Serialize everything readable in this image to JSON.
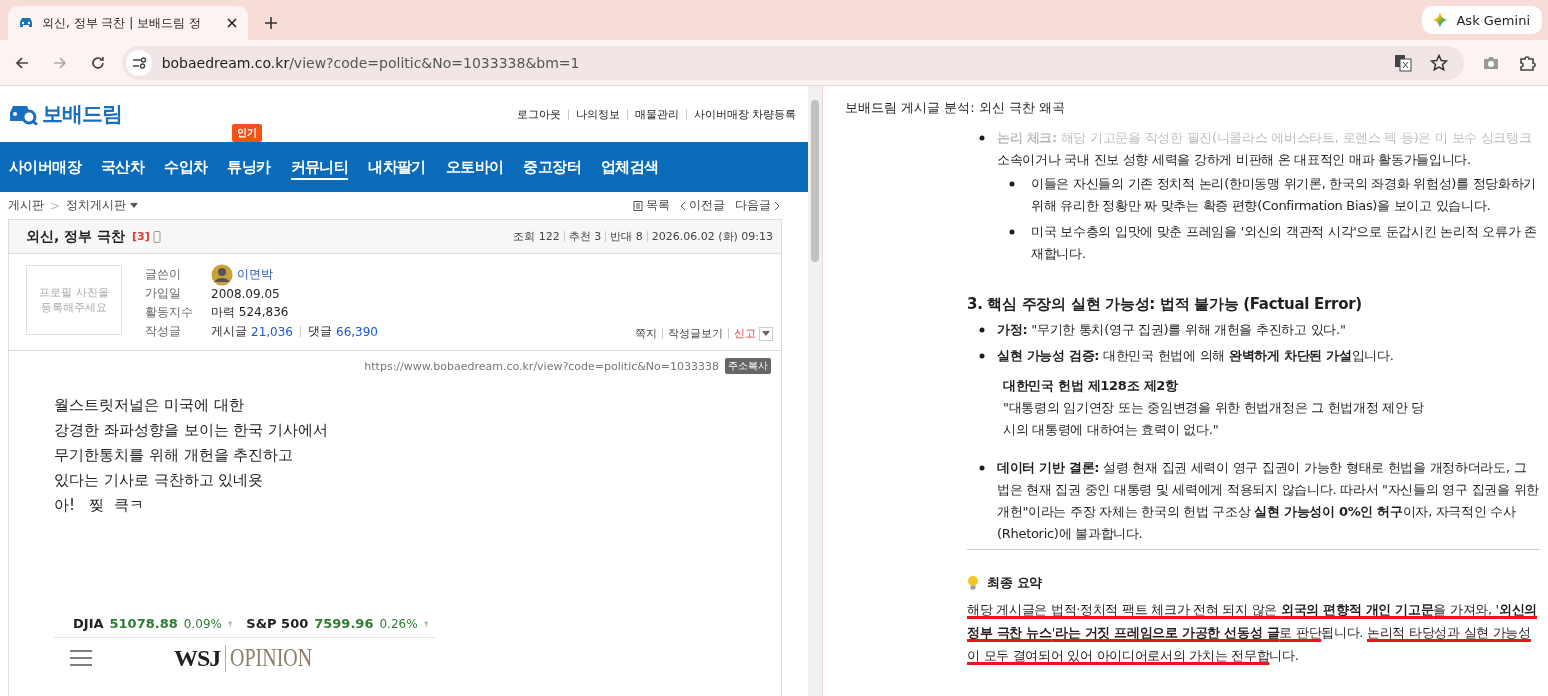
{
  "browser": {
    "tab_title": "외신, 정부 극찬 | 보배드림 정",
    "url_host": "bobaedream.co.kr",
    "url_path": "/view?code=politic&No=1033338&bm=1",
    "ask_button": "Ask Gemini"
  },
  "site": {
    "logo": "보배드림",
    "top_links": [
      "로그아웃",
      "나의정보",
      "매물관리",
      "사이버매장 차량등록"
    ],
    "nav": [
      {
        "label": "사이버매장",
        "selected": false
      },
      {
        "label": "국산차",
        "selected": false
      },
      {
        "label": "수입차",
        "selected": false
      },
      {
        "label": "튜닝카",
        "selected": false,
        "badge": "인기"
      },
      {
        "label": "커뮤니티",
        "selected": true
      },
      {
        "label": "내차팔기",
        "selected": false
      },
      {
        "label": "오토바이",
        "selected": false
      },
      {
        "label": "중고장터",
        "selected": false
      },
      {
        "label": "업체검색",
        "selected": false
      }
    ],
    "breadcrumb": [
      "게시판",
      "정치게시판"
    ],
    "breadcrumb_separator": ">",
    "post_nav": [
      {
        "label": "목록",
        "kind": "list"
      },
      {
        "label": "이전글",
        "kind": "prev"
      },
      {
        "label": "다음글",
        "kind": "next"
      }
    ]
  },
  "post": {
    "title": "외신, 정부 극찬",
    "comment_count": "[3]",
    "stats": [
      "조회 122",
      "추천 3",
      "반대 8",
      "2026.06.02 (화) 09:13"
    ],
    "profile_placeholder": "프로필 사진을 등록해주세요",
    "fields": [
      {
        "label": "글쓴이",
        "kind": "author",
        "value": "이면박"
      },
      {
        "label": "가입일",
        "kind": "text",
        "value": "2008.09.05"
      },
      {
        "label": "활동지수",
        "kind": "text",
        "value": "마력 524,836"
      },
      {
        "label": "작성글",
        "kind": "counts",
        "counts": [
          {
            "label": "게시글",
            "count": "21,036"
          },
          {
            "label": "댓글",
            "count": "66,390"
          }
        ]
      }
    ],
    "actions": [
      {
        "label": "쪽지",
        "kind": "normal"
      },
      {
        "label": "작성글보기",
        "kind": "normal"
      },
      {
        "label": "신고",
        "kind": "report"
      }
    ],
    "permalink": "https://www.bobaedream.co.kr/view?code=politic&No=1033338",
    "copy_button": "주소복사",
    "body": [
      "월스트릿저널은 미국에 대한",
      "강경한 좌파성향을 보이는 한국 기사에서",
      "무기한통치를 위해 개헌을 추진하고",
      "있다는 기사로 극찬하고 있네욧",
      "아!   찢  큭ㅋ"
    ],
    "embed": {
      "tickers": [
        {
          "name": "DJIA",
          "value": "51078.88",
          "change": "0.09%"
        },
        {
          "name": "S&P 500",
          "value": "7599.96",
          "change": "0.26%"
        }
      ],
      "brand": "WSJ",
      "section": "OPINION"
    }
  },
  "assistant": {
    "title": "보배드림 게시글 분석: 외신 극찬 왜곡",
    "blocks": [
      {
        "kind": "bullet",
        "faded": true,
        "text": "**논리 체크:** 해당 기고문을 작성한 필진(니콜라스 에버스타트, 로렌스 펙 등)은 미 보수 싱크탱크 소속이거나 국내 진보 성향 세력을 강하게 비판해 온 대표적인 매파 활동가들입니다.",
        "children": [
          {
            "kind": "bullet",
            "faded": false,
            "text": "이들은 자신들의 기존 정치적 논리(한미동맹 위기론, 한국의 좌경화 위험성)를 정당화하기 위해 유리한 정황만 짜 맞추는 확증 편향(Confirmation Bias)을 보이고 있습니다."
          },
          {
            "kind": "bullet",
            "faded": false,
            "text": "미국 보수층의 입맛에 맞춘 프레임을 '외신의 객관적 시각'으로 둔갑시킨 논리적 오류가 존재합니다."
          }
        ]
      },
      {
        "kind": "heading",
        "text": "3. 핵심 주장의 실현 가능성: 법적 불가능 (Factual Error)"
      },
      {
        "kind": "bullet",
        "faded": false,
        "text": "**가정:** \"무기한 통치(영구 집권)를 위해 개헌을 추진하고 있다.\""
      },
      {
        "kind": "bullet",
        "faded": false,
        "text": "**실현 가능성 검증:** 대한민국 헌법에 의해 **완벽하게 차단된 가설**입니다.",
        "children": [
          {
            "kind": "quote",
            "title": "대한민국 헌법 제128조 제2항",
            "text": "\"대통령의 임기연장 또는 중임변경을 위한 헌법개정은 그 헌법개정 제안 당시의 대통령에 대하여는 효력이 없다.\""
          }
        ]
      },
      {
        "kind": "bullet",
        "faded": false,
        "text": "**데이터 기반 결론:** 설령 현재 집권 세력이 영구 집권이 가능한 형태로 헌법을 개정하더라도, 그 법은 현재 집권 중인 대통령 및 세력에게 적용되지 않습니다. 따라서 \"자신들의 영구 집권을 위한 개헌\"이라는 주장 자체는 한국의 헌법 구조상 **실현 가능성이 0%인 허구**이자, 자극적인 수사(Rhetoric)에 불과합니다."
      },
      {
        "kind": "divider"
      },
      {
        "kind": "summary",
        "title": "최종 요약",
        "segments": [
          {
            "text": "해당 게시글은 법적·정치적 팩트 체크가 전혀 되지 않은 **외국의 편향적 개인 기고문**을 가져와, '**외신의 정부 극찬 뉴스**'**라는 거짓 프레임으로 가공한 선동성 글**로 판단",
            "underlined": true
          },
          {
            "text": "됩니다. ",
            "underlined": false
          },
          {
            "text": "논리적 타당성과 실현 가능성이 모두 결여되어 있어 아이디어로서의 가치는 전무합",
            "underlined": true
          },
          {
            "text": "니다.",
            "underlined": false
          }
        ]
      }
    ]
  }
}
